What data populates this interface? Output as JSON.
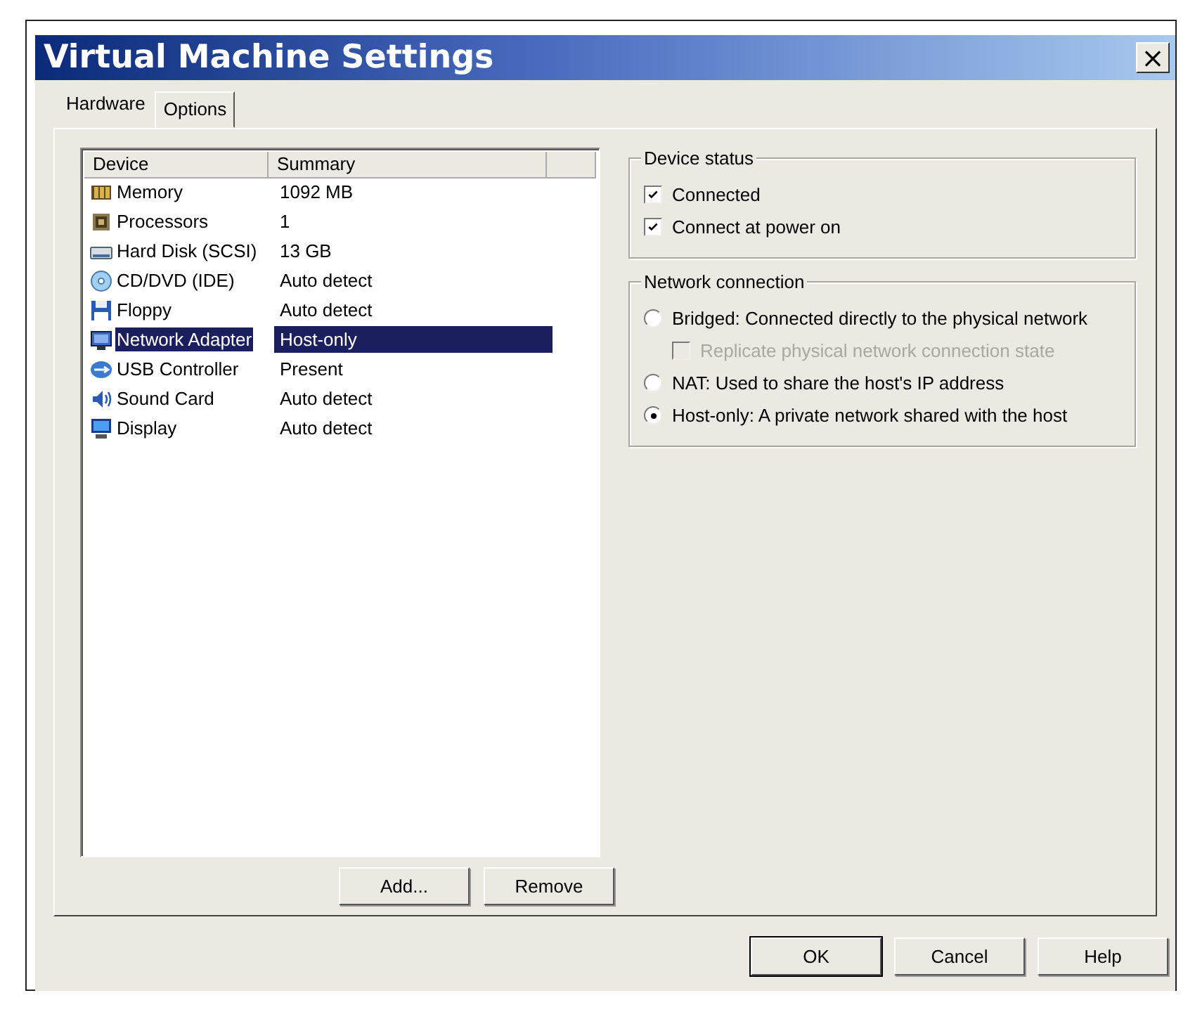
{
  "window": {
    "title": "Virtual Machine Settings",
    "close": "×"
  },
  "tabs": [
    {
      "label": "Hardware",
      "selected": true
    },
    {
      "label": "Options",
      "selected": false
    }
  ],
  "device_list": {
    "columns": [
      "Device",
      "Summary"
    ],
    "rows": [
      {
        "kind": "memory",
        "device": "Memory",
        "summary": "1092 MB",
        "selected": false
      },
      {
        "kind": "processor",
        "device": "Processors",
        "summary": "1",
        "selected": false
      },
      {
        "kind": "disk",
        "device": "Hard Disk (SCSI)",
        "summary": "13 GB",
        "selected": false
      },
      {
        "kind": "cdrom",
        "device": "CD/DVD (IDE)",
        "summary": "Auto detect",
        "selected": false
      },
      {
        "kind": "floppy",
        "device": "Floppy",
        "summary": "Auto detect",
        "selected": false
      },
      {
        "kind": "network",
        "device": "Network Adapter",
        "summary": "Host-only",
        "selected": true
      },
      {
        "kind": "usb",
        "device": "USB Controller",
        "summary": "Present",
        "selected": false
      },
      {
        "kind": "sound",
        "device": "Sound Card",
        "summary": "Auto detect",
        "selected": false
      },
      {
        "kind": "display",
        "device": "Display",
        "summary": "Auto detect",
        "selected": false
      }
    ]
  },
  "list_buttons": [
    "Add...",
    "Remove"
  ],
  "device_status": {
    "label": "Device status",
    "options": [
      {
        "kind": "checkbox",
        "label": "Connected",
        "checked": true,
        "disabled": false
      },
      {
        "kind": "checkbox",
        "label": "Connect at power on",
        "checked": true,
        "disabled": false
      }
    ]
  },
  "network_connection": {
    "label": "Network connection",
    "options": [
      {
        "kind": "radio",
        "label": "Bridged: Connected directly to the physical network",
        "selected": false,
        "disabled": false
      },
      {
        "kind": "checkbox",
        "label": "Replicate physical network connection state",
        "checked": false,
        "disabled": true
      },
      {
        "kind": "radio",
        "label": "NAT: Used to share the host's IP address",
        "selected": false,
        "disabled": false
      },
      {
        "kind": "radio",
        "label": "Host-only: A private network shared with the host",
        "selected": true,
        "disabled": false
      }
    ]
  },
  "dialog_buttons": [
    {
      "label": "OK",
      "default": true
    },
    {
      "label": "Cancel",
      "default": false
    },
    {
      "label": "Help",
      "default": false
    }
  ]
}
